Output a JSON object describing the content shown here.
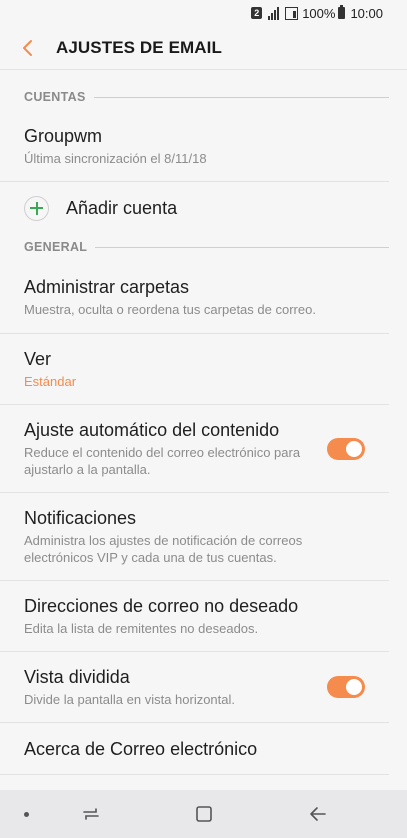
{
  "status_bar": {
    "sim_number": "2",
    "battery_percent": "100%",
    "time": "10:00"
  },
  "header": {
    "title": "AJUSTES DE EMAIL",
    "back_icon": "chevron-left-icon",
    "accent_color": "#f58b4c"
  },
  "sections": {
    "accounts": {
      "label": "CUENTAS",
      "account": {
        "name": "Groupwm",
        "sync": "Última sincronización el 8/11/18"
      },
      "add_label": "Añadir cuenta"
    },
    "general": {
      "label": "GENERAL",
      "items": [
        {
          "title": "Administrar carpetas",
          "subtitle": "Muestra, oculta o reordena tus carpetas de correo."
        },
        {
          "title": "Ver",
          "subtitle": "Estándar"
        },
        {
          "title": "Ajuste automático del contenido",
          "subtitle": "Reduce el contenido del correo electrónico para ajustarlo a la pantalla.",
          "toggle": true
        },
        {
          "title": "Notificaciones",
          "subtitle": "Administra los ajustes de notificación de correos electrónicos VIP y cada una de tus cuentas."
        },
        {
          "title": "Direcciones de correo no deseado",
          "subtitle": "Edita la lista de remitentes no deseados."
        },
        {
          "title": "Vista dividida",
          "subtitle": "Divide la pantalla en vista horizontal.",
          "toggle": true
        },
        {
          "title": "Acerca de Correo electrónico"
        }
      ]
    }
  },
  "nav_bar": {
    "icons": [
      "dot-icon",
      "recent-apps-icon",
      "home-icon",
      "back-arrow-icon"
    ]
  }
}
